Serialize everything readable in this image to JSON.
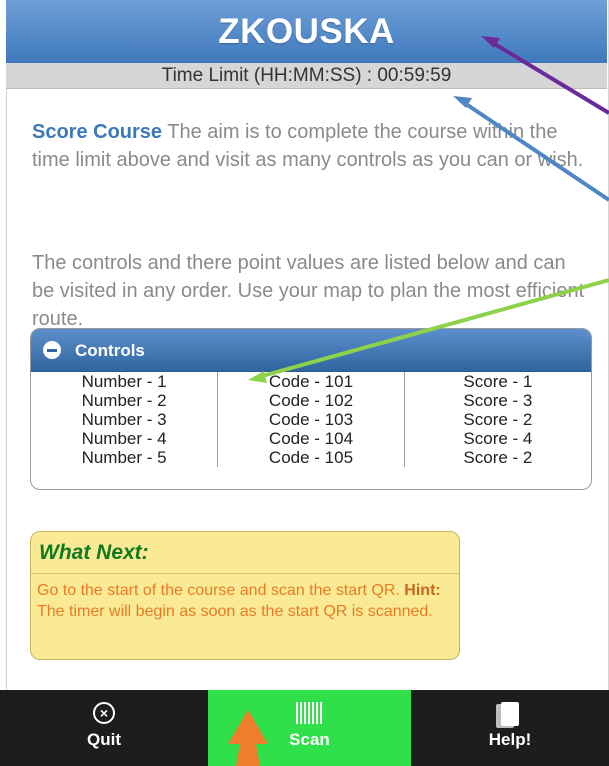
{
  "header": {
    "title": "ZKOUSKA"
  },
  "time_limit": "Time Limit (HH:MM:SS) : 00:59:59",
  "intro": {
    "bold": "Score Course",
    "text": " The aim is to complete the course within the time limit above and visit as many controls as you can or wish."
  },
  "intro2": "The controls and there point values are listed below and can be visited in any order. Use your map to plan the most efficient route.",
  "controls": {
    "title": "Controls",
    "rows": [
      {
        "number": "Number - 1",
        "code": "Code - 101",
        "score": "Score - 1"
      },
      {
        "number": "Number - 2",
        "code": "Code - 102",
        "score": "Score - 3"
      },
      {
        "number": "Number - 3",
        "code": "Code - 103",
        "score": "Score - 2"
      },
      {
        "number": "Number - 4",
        "code": "Code - 104",
        "score": "Score - 4"
      },
      {
        "number": "Number - 5",
        "code": "Code - 105",
        "score": "Score - 2"
      }
    ]
  },
  "what_next": {
    "title": "What Next:",
    "text_a": "Go to the start of the course and scan the start QR. ",
    "hint_label": "Hint:",
    "text_b": " The timer will begin as soon as the start QR is scanned."
  },
  "footer": {
    "quit": "Quit",
    "scan": "Scan",
    "help": "Help!"
  },
  "colors": {
    "header": "#4a82c4",
    "scan_button": "#2fe04a",
    "what_next_bg": "#fbea95"
  }
}
